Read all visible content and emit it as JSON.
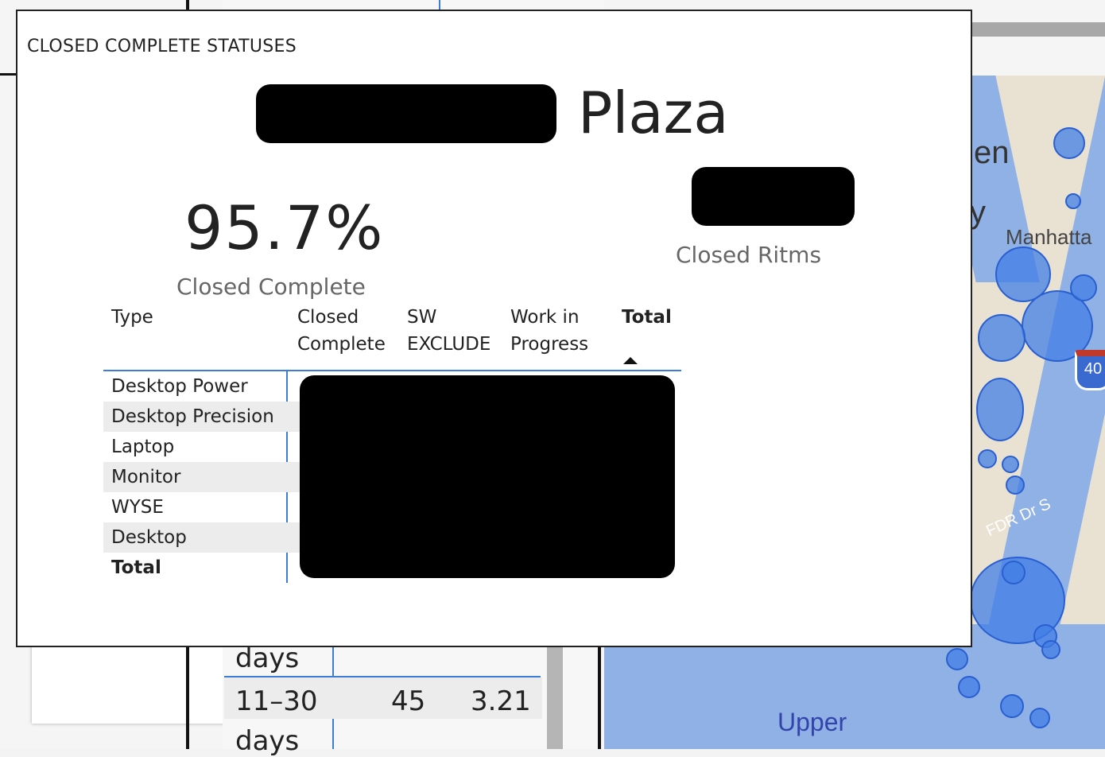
{
  "background": {
    "rows": [
      {
        "label": "days",
        "val1": "",
        "val2": ""
      },
      {
        "label": "11–30",
        "val1": "45",
        "val2": "3.21"
      },
      {
        "label": "days",
        "val1": "",
        "val2": ""
      }
    ],
    "map_labels": {
      "manhattan": "Manhatta",
      "en": "en",
      "y": "y",
      "fdr": "FDR Dr S",
      "upper": "Upper",
      "shield": "40"
    }
  },
  "dialog": {
    "title": "CLOSED COMPLETE STATUSES",
    "location_suffix": "Plaza",
    "kpi_percent": "95.7%",
    "kpi_percent_label": "Closed Complete",
    "kpi_ritms_label": "Closed Ritms",
    "table": {
      "headers": {
        "type": "Type",
        "closed_line1": "Closed",
        "closed_line2": "Complete",
        "sw_line1": "SW",
        "sw_line2": "EXCLUDE",
        "wip_line1": "Work in",
        "wip_line2": "Progress",
        "total": "Total"
      },
      "rows": [
        "Desktop Power",
        "Desktop Precision",
        "Laptop",
        "Monitor",
        "WYSE",
        "Desktop"
      ],
      "total_label": "Total"
    }
  },
  "colors": {
    "accent_blue": "#3b7dd8",
    "bubble_blue": "#427ee6",
    "redaction": "#000000"
  }
}
